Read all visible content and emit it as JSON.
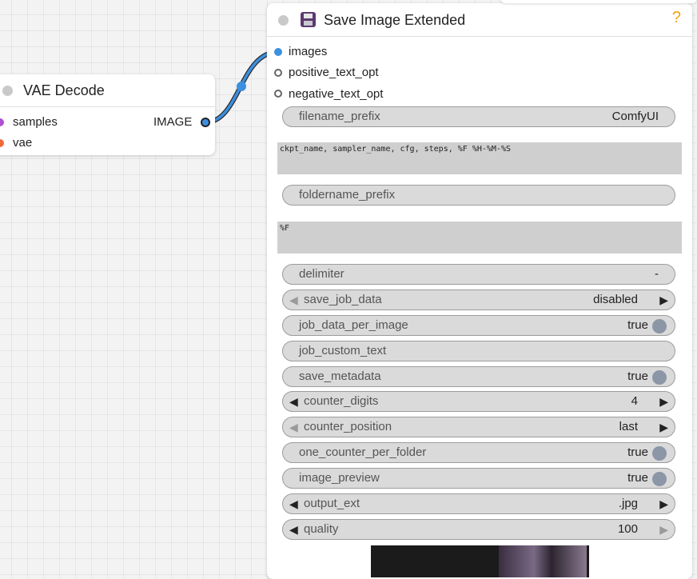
{
  "vae_node": {
    "title": "VAE Decode",
    "inputs": [
      {
        "label": "samples",
        "color": "#b04fcf"
      },
      {
        "label": "vae",
        "color": "#ef6a3a"
      }
    ],
    "output": {
      "label": "IMAGE",
      "color": "#3d8fe0"
    }
  },
  "save_node": {
    "title": "Save Image Extended",
    "icon": "floppy-disk-icon",
    "help": "?",
    "inputs": [
      {
        "label": "images",
        "color": "#3d8fe0",
        "connected": true
      },
      {
        "label": "positive_text_opt",
        "connected": false
      },
      {
        "label": "negative_text_opt",
        "connected": false
      }
    ],
    "widgets": {
      "filename_prefix": {
        "label": "filename_prefix",
        "value": "ComfyUI"
      },
      "filename_keys": "ckpt_name, sampler_name, cfg, steps, %F %H-%M-%S",
      "foldername_prefix": {
        "label": "foldername_prefix",
        "value": ""
      },
      "foldername_keys": "%F",
      "delimiter": {
        "label": "delimiter",
        "value": "-"
      },
      "save_job_data": {
        "label": "save_job_data",
        "value": "disabled"
      },
      "job_data_per_image": {
        "label": "job_data_per_image",
        "value": "true"
      },
      "job_custom_text": {
        "label": "job_custom_text",
        "value": ""
      },
      "save_metadata": {
        "label": "save_metadata",
        "value": "true"
      },
      "counter_digits": {
        "label": "counter_digits",
        "value": "4"
      },
      "counter_position": {
        "label": "counter_position",
        "value": "last"
      },
      "one_counter_per_folder": {
        "label": "one_counter_per_folder",
        "value": "true"
      },
      "image_preview": {
        "label": "image_preview",
        "value": "true"
      },
      "output_ext": {
        "label": "output_ext",
        "value": ".jpg"
      },
      "quality": {
        "label": "quality",
        "value": "100"
      }
    }
  },
  "colors": {
    "link": "#3d8fe0",
    "help": "#f3a10b",
    "toggle": "#8b96a6"
  }
}
